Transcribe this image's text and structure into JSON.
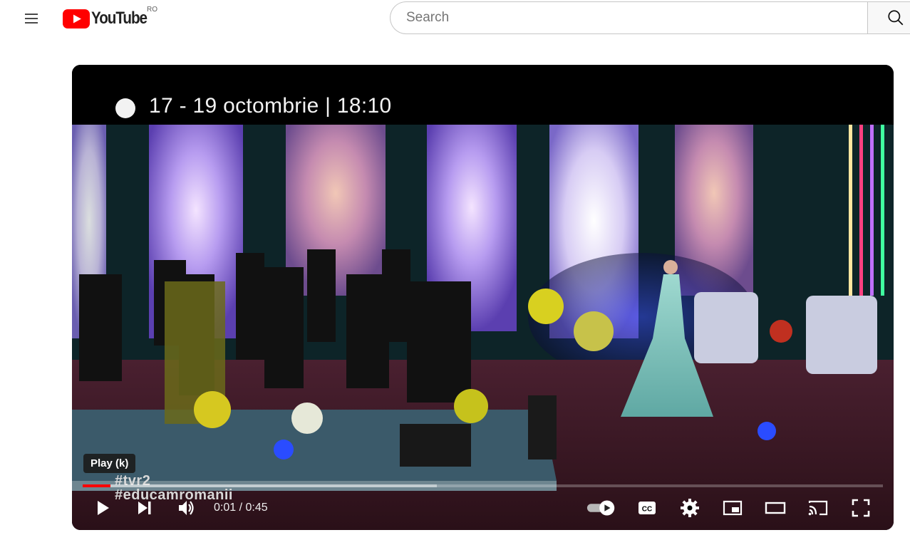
{
  "masthead": {
    "logo_text": "YouTube",
    "country_code": "RO",
    "search_placeholder": "Search"
  },
  "video": {
    "banner_text": "17 - 19 octombrie | 18:10",
    "overlay_tags": [
      "#tvr2",
      "#educamromanii"
    ],
    "tooltip": "Play (k)",
    "time_display": "0:01 / 0:45",
    "progress_played_fraction": 0.035,
    "progress_loaded_fraction": 0.443,
    "autoplay_on": true
  },
  "icons": {
    "menu": "menu-icon",
    "logo": "youtube-logo-icon",
    "search": "search-icon",
    "play": "play-icon",
    "next": "next-icon",
    "volume": "volume-icon",
    "autoplay": "autoplay-toggle-icon",
    "cc": "subtitles-icon",
    "settings": "gear-icon",
    "miniplayer": "miniplayer-icon",
    "theater": "theater-mode-icon",
    "cast": "cast-icon",
    "fullscreen": "fullscreen-icon"
  },
  "colors": {
    "brand_red": "#ff0000",
    "player_bg": "#000000"
  }
}
